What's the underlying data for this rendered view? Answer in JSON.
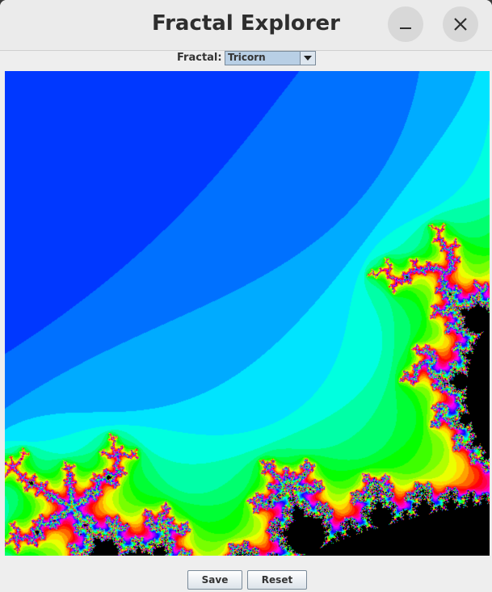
{
  "window": {
    "title": "Fractal Explorer"
  },
  "toolbar": {
    "fractal_label": "Fractal:",
    "fractal_selected": "Tricorn"
  },
  "buttons": {
    "save_label": "Save",
    "reset_label": "Reset"
  },
  "icons": {
    "minimize": "minimize-icon",
    "close": "close-icon",
    "dropdown": "chevron-down-icon"
  },
  "colors": {
    "combo_bg": "#b8cfe5",
    "fractal_outer": "#8800ff",
    "fractal_mid": "#ff00d0",
    "fractal_set": "#000000"
  }
}
